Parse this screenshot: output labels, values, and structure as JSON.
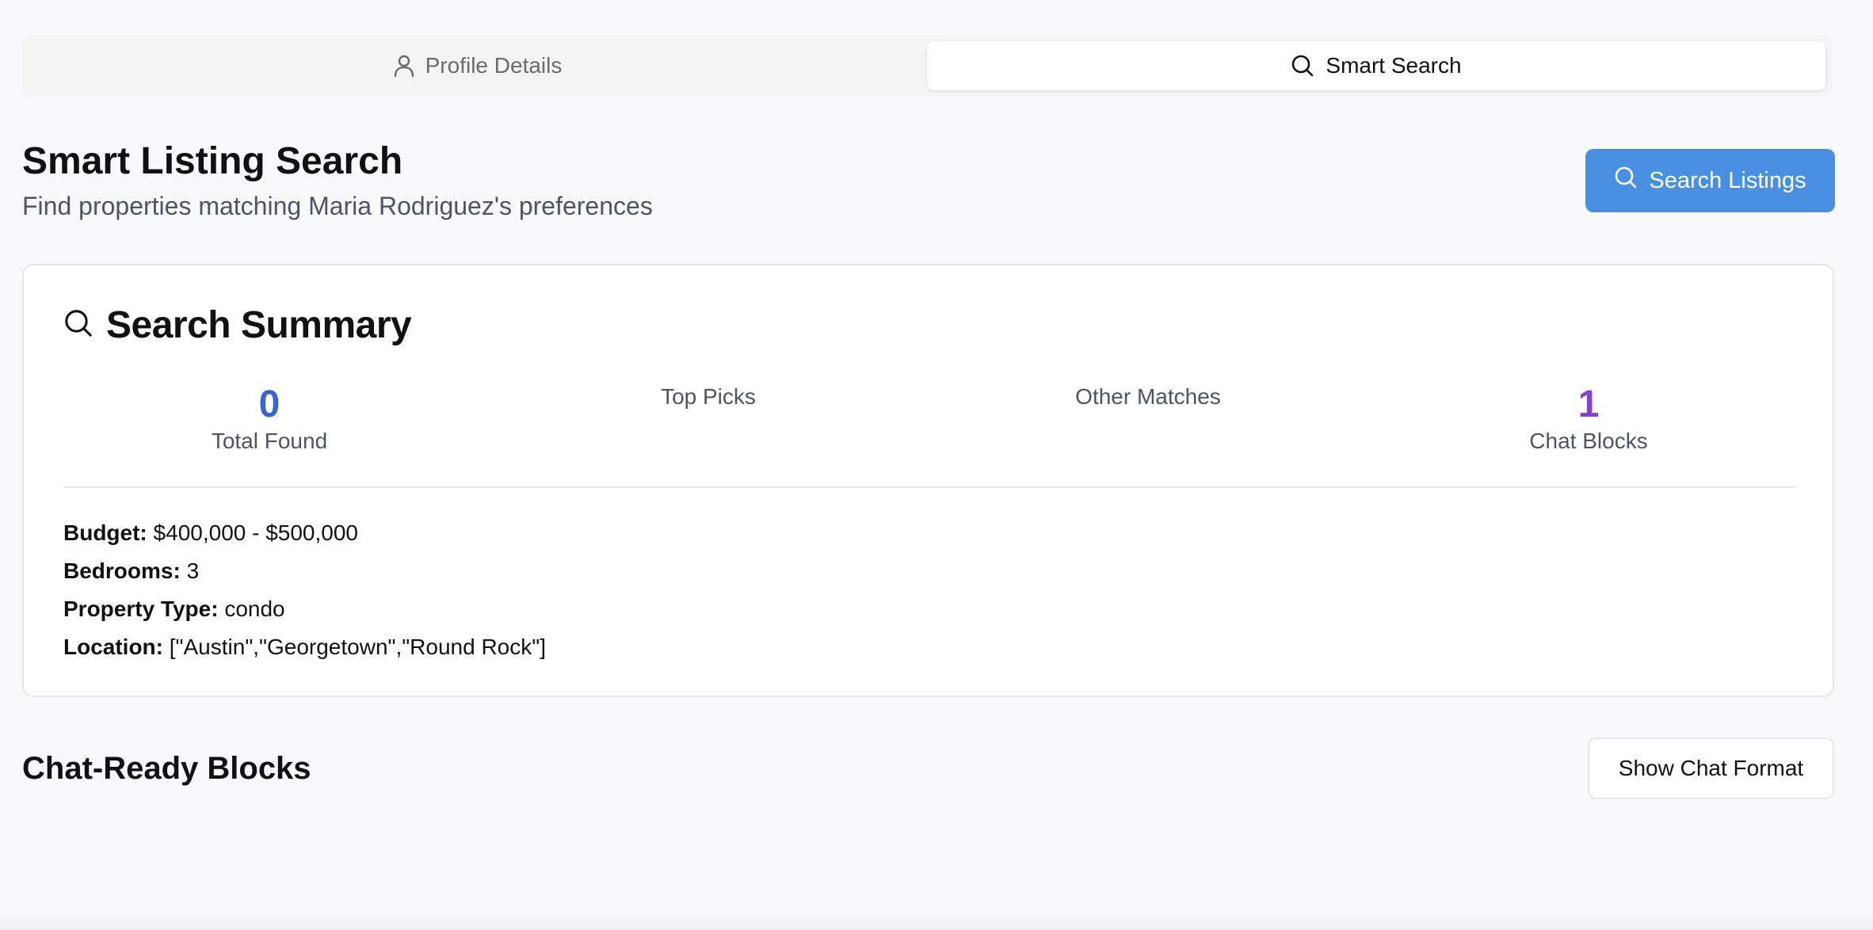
{
  "tabs": {
    "profile": {
      "label": "Profile Details",
      "icon": "user-icon"
    },
    "smart_search": {
      "label": "Smart Search",
      "icon": "search-icon",
      "active": true
    }
  },
  "header": {
    "title": "Smart Listing Search",
    "subtitle": "Find properties matching Maria Rodriguez's preferences",
    "search_button": "Search Listings"
  },
  "summary": {
    "title": "Search Summary",
    "stats": {
      "total_found": {
        "value": "0",
        "label": "Total Found",
        "color": "#3b63d6"
      },
      "top_picks": {
        "value": "",
        "label": "Top Picks"
      },
      "other_matches": {
        "value": "",
        "label": "Other Matches"
      },
      "chat_blocks": {
        "value": "1",
        "label": "Chat Blocks",
        "color": "#8a3fd1"
      }
    },
    "criteria": {
      "budget_label": "Budget:",
      "budget_value": "$400,000 - $500,000",
      "bedrooms_label": "Bedrooms:",
      "bedrooms_value": "3",
      "property_type_label": "Property Type:",
      "property_type_value": "condo",
      "location_label": "Location:",
      "location_value": "[\"Austin\",\"Georgetown\",\"Round Rock\"]"
    }
  },
  "chat_section": {
    "title": "Chat-Ready Blocks",
    "show_format_button": "Show Chat Format"
  },
  "colors": {
    "accent": "#4a90e2",
    "total_found": "#3b63d6",
    "chat_blocks": "#8a3fd1"
  }
}
